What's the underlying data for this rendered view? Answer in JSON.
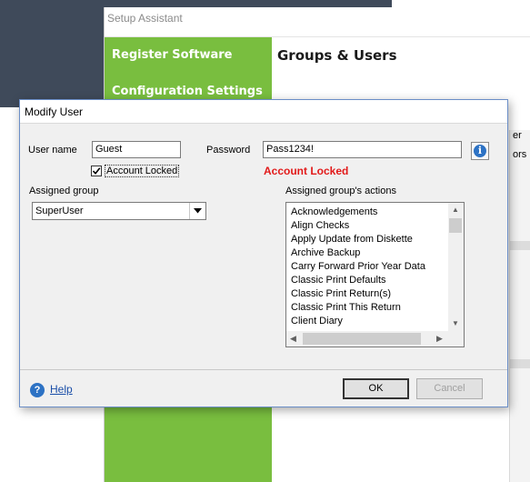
{
  "background_window": {
    "title": "Setup Assistant",
    "sidebar_items": [
      "Register Software",
      "Configuration Settings"
    ],
    "heading": "Groups & Users",
    "partial_column_text": [
      "er",
      "ors"
    ]
  },
  "dialog": {
    "title": "Modify User",
    "user_name_label": "User name",
    "user_name_value": "Guest",
    "password_label": "Password",
    "password_value": "Pass1234!",
    "account_locked_checkbox_label": "Account Locked",
    "account_locked_checked": true,
    "account_locked_status": "Account Locked",
    "assigned_group_label": "Assigned group",
    "assigned_group_value": "SuperUser",
    "actions_label": "Assigned group's actions",
    "actions": [
      "Acknowledgements",
      "Align Checks",
      "Apply Update from Diskette",
      "Archive Backup",
      "Carry Forward Prior Year Data",
      "Classic Print Defaults",
      "Classic Print Return(s)",
      "Classic Print This Return",
      "Client Diary"
    ],
    "help_label": "Help",
    "ok_label": "OK",
    "cancel_label": "Cancel"
  },
  "colors": {
    "sidebar_green": "#79be3f",
    "locked_red": "#e21a1a",
    "desktop_dark": "#3f4a5a",
    "info_blue": "#2d72c4"
  },
  "icons": [
    "info-icon",
    "help-icon",
    "checkmark-icon",
    "dropdown-arrow-icon",
    "scroll-arrow-icon"
  ]
}
